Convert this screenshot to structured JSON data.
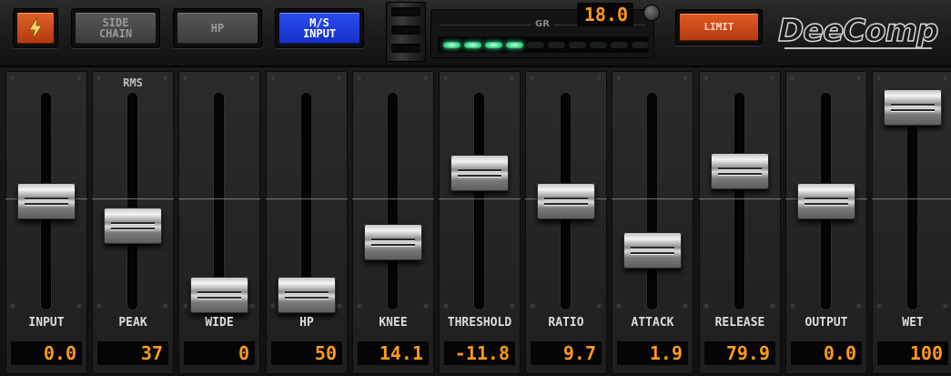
{
  "header": {
    "power_icon": "lightning-bolt-icon",
    "sidechain_label": "SIDE\nCHAIN",
    "hp_label": "HP",
    "ms_label": "M/S\nINPUT",
    "gr_label": "GR",
    "gr_value": "18.0",
    "gr_leds_on": 4,
    "gr_leds_total": 10,
    "limit_label": "LIMIT",
    "logo": "DeeComp",
    "colors": {
      "power": "#d0501c",
      "ms_input": "#1e3ce0",
      "limit": "#c94716",
      "readout": "#ff9a1a",
      "led": "#4fe39a"
    }
  },
  "strips": [
    {
      "label": "INPUT",
      "top_label": "",
      "value": "0.0",
      "level": 0.5
    },
    {
      "label": "PEAK",
      "top_label": "RMS",
      "value": "37",
      "level": 0.37
    },
    {
      "label": "WIDE",
      "top_label": "",
      "value": "0",
      "level": 0.0
    },
    {
      "label": "HP",
      "top_label": "",
      "value": "50",
      "level": 0.0
    },
    {
      "label": "KNEE",
      "top_label": "",
      "value": "14.1",
      "level": 0.28
    },
    {
      "label": "THRESHOLD",
      "top_label": "",
      "value": "-11.8",
      "level": 0.65
    },
    {
      "label": "RATIO",
      "top_label": "",
      "value": "9.7",
      "level": 0.5
    },
    {
      "label": "ATTACK",
      "top_label": "",
      "value": "1.9",
      "level": 0.24
    },
    {
      "label": "RELEASE",
      "top_label": "",
      "value": "79.9",
      "level": 0.66
    },
    {
      "label": "OUTPUT",
      "top_label": "",
      "value": "0.0",
      "level": 0.5
    },
    {
      "label": "WET",
      "top_label": "",
      "value": "100",
      "level": 1.0
    }
  ]
}
